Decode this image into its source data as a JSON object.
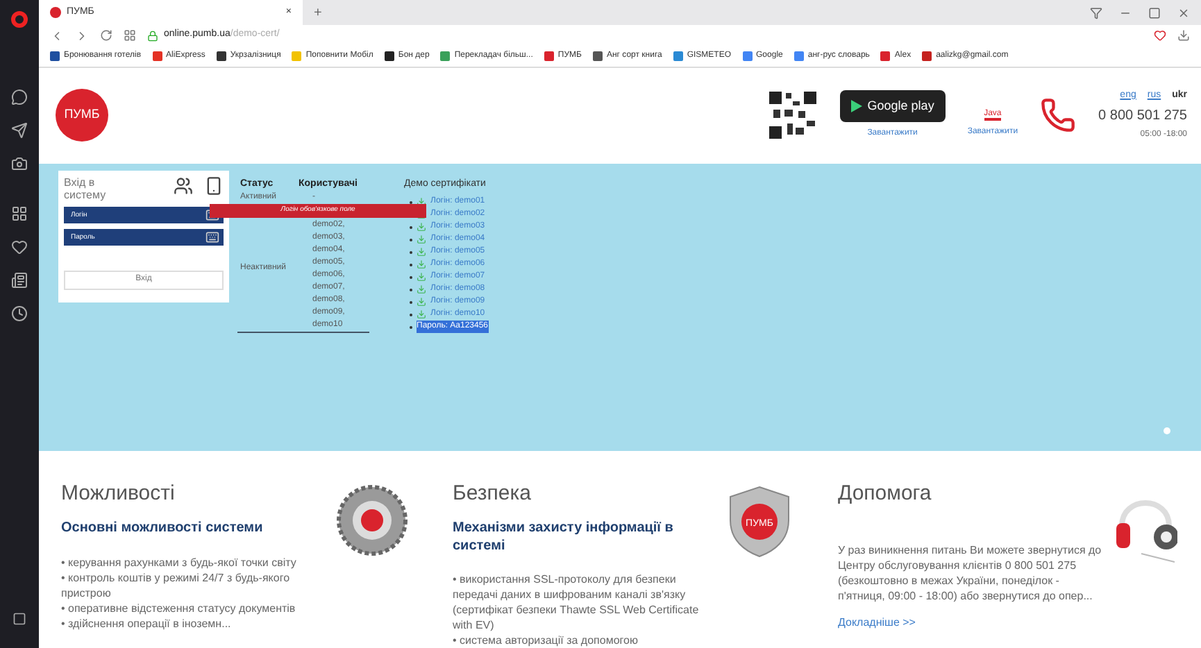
{
  "browser": {
    "tab": {
      "title": "ПУМБ",
      "close": "×"
    },
    "new_tab": "+",
    "url": {
      "host": "online.pumb.ua",
      "path": "/demo-cert/"
    },
    "bookmarks": [
      {
        "label": "Бронювання готелів",
        "color": "#1e4fa0"
      },
      {
        "label": "AliExpress",
        "color": "#e43225"
      },
      {
        "label": "Укрзалізниця",
        "color": "#333333"
      },
      {
        "label": "Поповнити Мобіл",
        "color": "#f2c200"
      },
      {
        "label": "Бон дер",
        "color": "#222222"
      },
      {
        "label": "Перекладач більш...",
        "color": "#3aa05a"
      },
      {
        "label": "ПУМБ",
        "color": "#d9232d"
      },
      {
        "label": "Анг сорт книга",
        "color": "#555555"
      },
      {
        "label": "GISMETEO",
        "color": "#2a8ad4"
      },
      {
        "label": "Google",
        "color": "#4285f4"
      },
      {
        "label": "анг-рус словарь",
        "color": "#4285f4"
      },
      {
        "label": "Alex",
        "color": "#d9232d"
      },
      {
        "label": "aalizkg@gmail.com",
        "color": "#c5221f"
      }
    ]
  },
  "header": {
    "logo": "ПУМБ",
    "google_play": "Google play",
    "download_links": [
      "Завантажити",
      "Завантажити"
    ],
    "java": "Java",
    "languages": [
      {
        "label": "eng",
        "selected": false
      },
      {
        "label": "rus",
        "selected": false
      },
      {
        "label": "ukr",
        "selected": true
      }
    ],
    "phone": "0 800 501 275",
    "hours": "05:00 -18:00"
  },
  "login": {
    "title": "Вхід в систему",
    "fields": [
      {
        "placeholder": "Логін"
      },
      {
        "placeholder": "Пароль"
      }
    ],
    "button": "Вхід",
    "error": "Логін обов'язкове поле"
  },
  "users_table": {
    "columns": [
      "Статус",
      "Користувачі"
    ],
    "rows": [
      {
        "status": "Активний",
        "users": [
          "-"
        ]
      },
      {
        "status": "Неактивний",
        "users": [
          "demo02,",
          "demo03,",
          "demo04,",
          "demo05,",
          "demo06,",
          "demo07,",
          "demo08,",
          "demo09,",
          "demo10"
        ]
      }
    ]
  },
  "demo_certs": {
    "title": "Демо сертифікати",
    "items": [
      "Логін: demo01",
      "Логін: demo02",
      "Логін: demo03",
      "Логін: demo04",
      "Логін: demo05",
      "Логін: demo06",
      "Логін: demo07",
      "Логін: demo08",
      "Логін: demo09",
      "Логін: demo10"
    ],
    "password": {
      "text": "Пароль: Aa123456",
      "selected": true
    }
  },
  "features": [
    {
      "kind": "gear",
      "title": "Можливості",
      "subtitle": "Основні можливості системи",
      "lines": [
        "• керування рахунками з будь-якої точки світу",
        "• контроль коштів у режимі 24/7 з будь-якого пристрою",
        "• оперативне відстеження статусу документів",
        "• здійснення операції в іноземн..."
      ]
    },
    {
      "kind": "shield",
      "badge": "ПУМБ",
      "title": "Безпека",
      "subtitle": "Механізми захисту інформації в системі",
      "lines": [
        "• використання SSL-протоколу для безпеки передачі даних в шифрованим каналі зв'язку (сертифікат безпеки Thawte SSL Web Certificate with EV)",
        "• система авторизації за допомогою"
      ]
    },
    {
      "kind": "headphones",
      "title": "Допомога",
      "lines": [
        "У раз виникнення питань Ви можете звернутися до Центру обслуговування клієнтів 0 800 501 275 (безкоштовно в межах України, понеділок - п'ятниця, 09:00 - 18:00) або звернутися до опер..."
      ],
      "more": "Докладніше >>"
    }
  ]
}
